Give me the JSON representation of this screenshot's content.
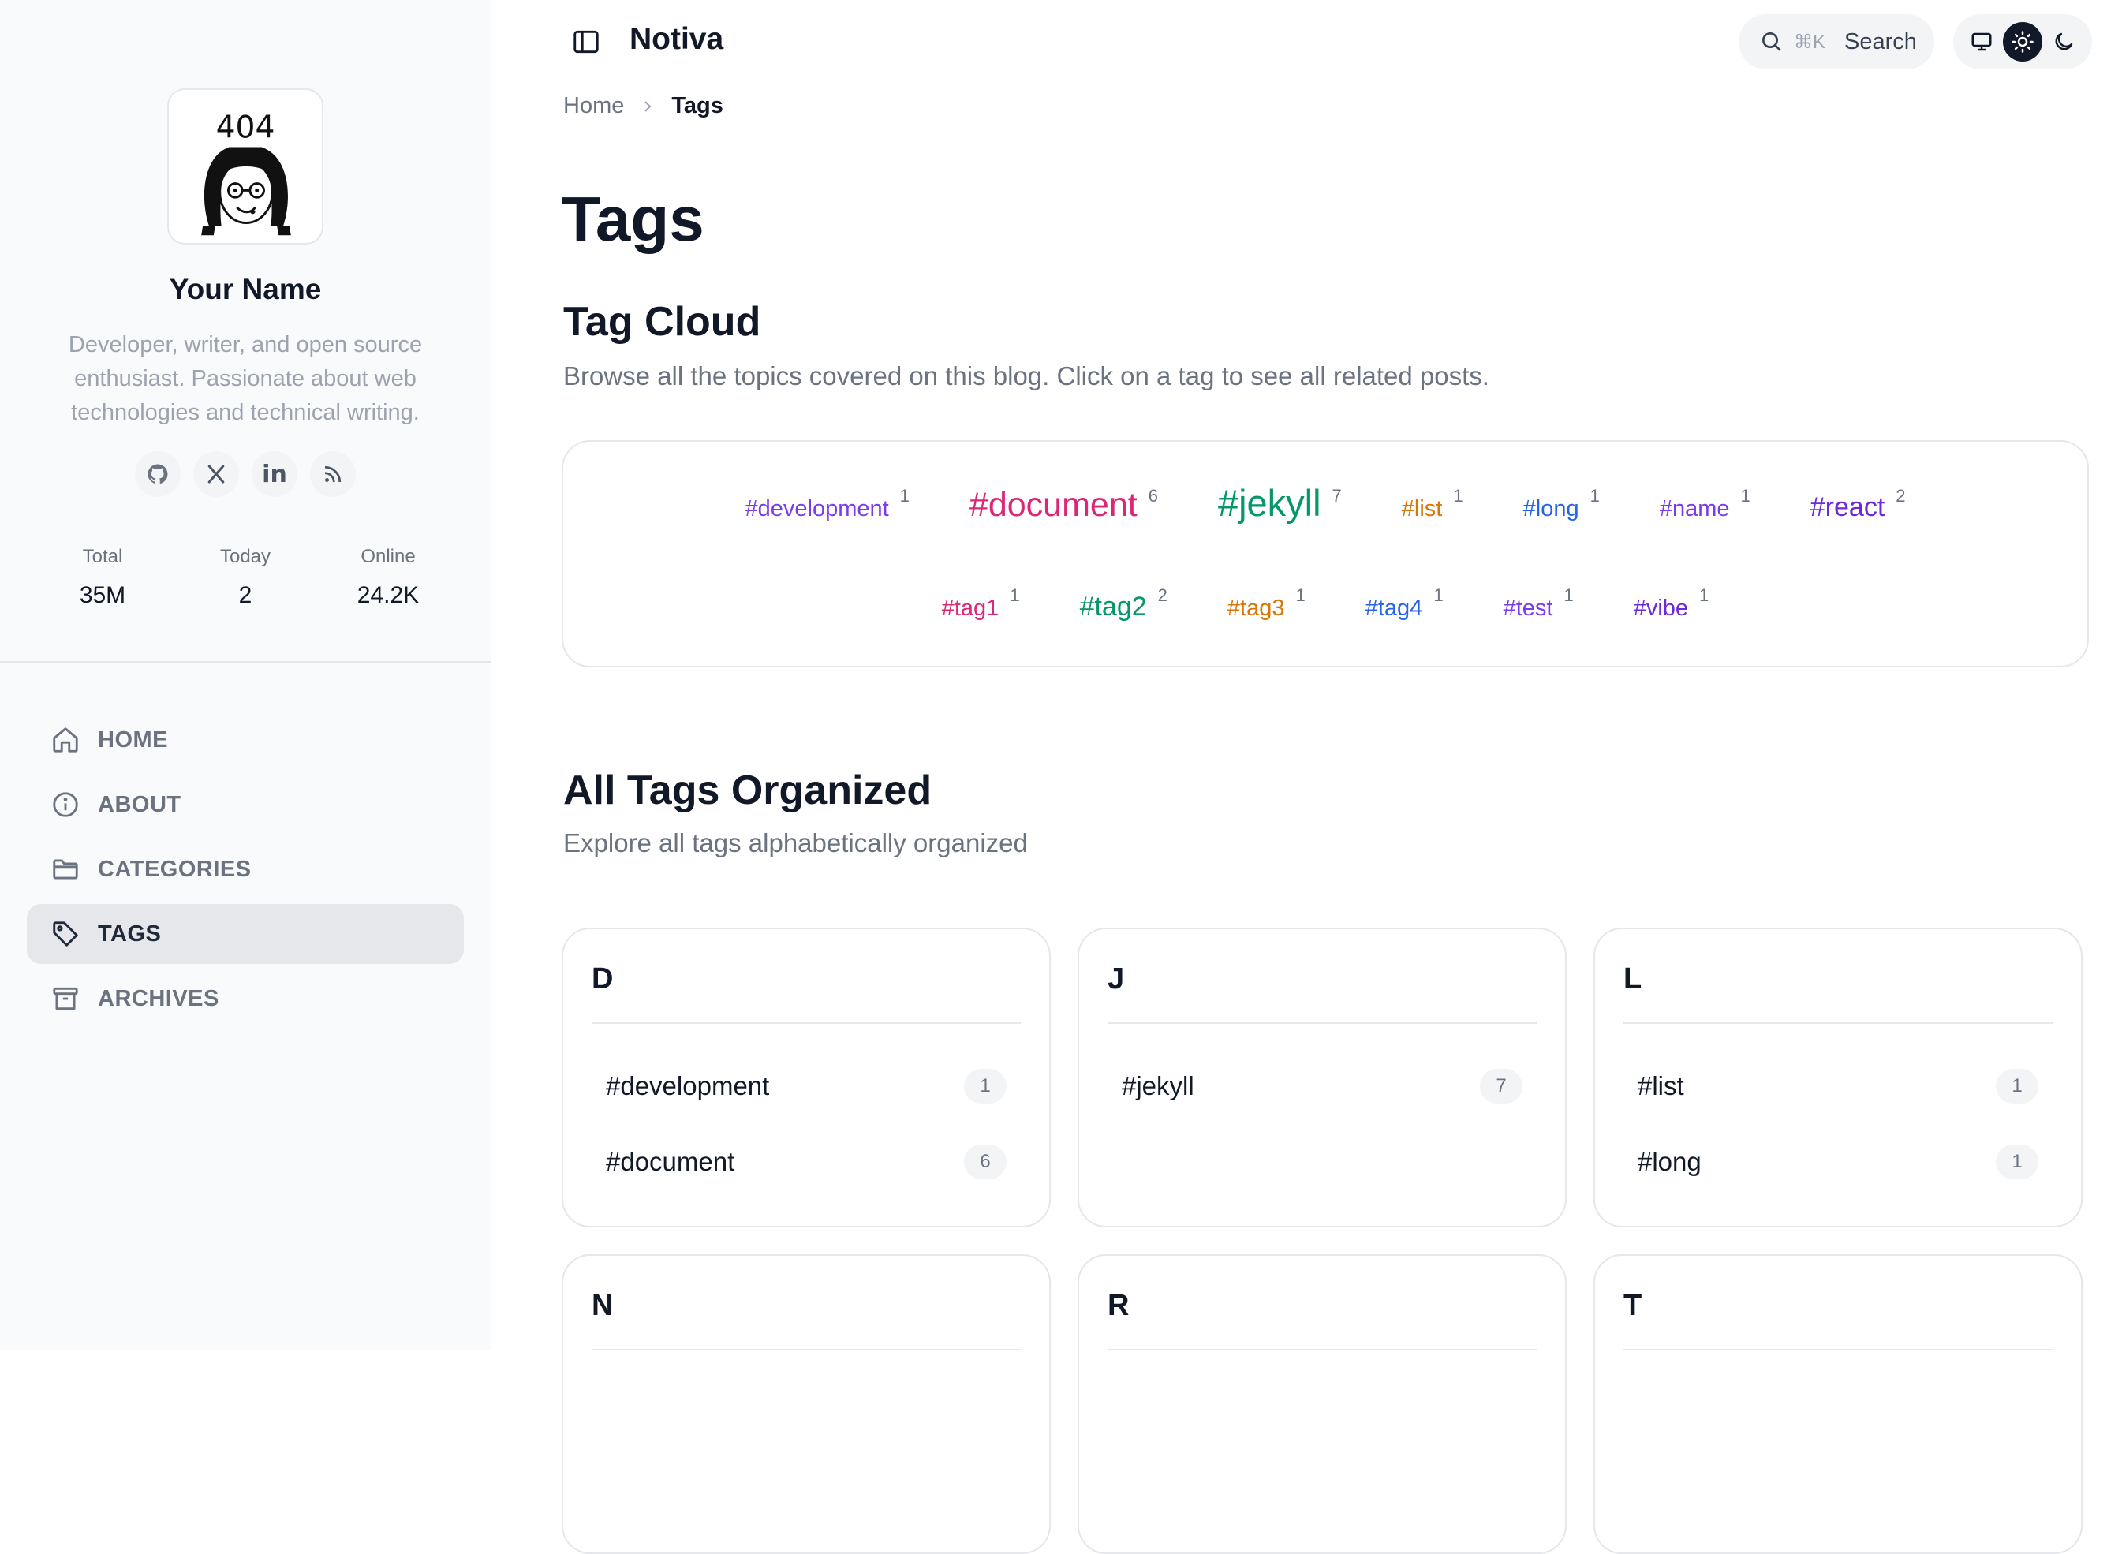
{
  "colors": {
    "sidebar_bg": "#f9fafb",
    "active_nav_bg": "#e5e7eb",
    "muted_text": "#6b7280",
    "cloud_violet": "#7c3aed",
    "cloud_pink": "#db2777",
    "cloud_green": "#059669",
    "cloud_orange": "#d97706",
    "cloud_blue": "#2563eb"
  },
  "sidebar": {
    "avatar_text": "404",
    "name": "Your Name",
    "bio": "Developer, writer, and open source enthusiast. Passionate about web technologies and technical writing.",
    "socials": [
      {
        "icon": "github-icon"
      },
      {
        "icon": "x-icon"
      },
      {
        "icon": "linkedin-icon",
        "label": "in"
      },
      {
        "icon": "rss-icon"
      }
    ],
    "stats": [
      {
        "label": "Total",
        "value": "35M"
      },
      {
        "label": "Today",
        "value": "2"
      },
      {
        "label": "Online",
        "value": "24.2K"
      }
    ],
    "nav": [
      {
        "label": "HOME",
        "icon": "home-icon"
      },
      {
        "label": "ABOUT",
        "icon": "info-icon"
      },
      {
        "label": "CATEGORIES",
        "icon": "folder-icon"
      },
      {
        "label": "TAGS",
        "icon": "tag-icon",
        "active": true
      },
      {
        "label": "ARCHIVES",
        "icon": "archive-icon"
      }
    ]
  },
  "header": {
    "brand": "Notiva",
    "search_shortcut": "⌘K",
    "search_label": "Search"
  },
  "breadcrumb": {
    "home": "Home",
    "current": "Tags"
  },
  "main": {
    "title": "Tags",
    "cloud_title": "Tag Cloud",
    "cloud_desc": "Browse all the topics covered on this blog. Click on a tag to see all related posts.",
    "cloud_rows": [
      [
        {
          "name": "#development",
          "count": "1",
          "color": "#7c3aed"
        },
        {
          "name": "#document",
          "count": "6",
          "color": "#db2777"
        },
        {
          "name": "#jekyll",
          "count": "7",
          "color": "#059669"
        },
        {
          "name": "#list",
          "count": "1",
          "color": "#d97706"
        },
        {
          "name": "#long",
          "count": "1",
          "color": "#2563eb"
        },
        {
          "name": "#name",
          "count": "1",
          "color": "#7c3aed"
        },
        {
          "name": "#react",
          "count": "2",
          "color": "#6d28d9"
        }
      ],
      [
        {
          "name": "#tag1",
          "count": "1",
          "color": "#db2777"
        },
        {
          "name": "#tag2",
          "count": "2",
          "color": "#059669"
        },
        {
          "name": "#tag3",
          "count": "1",
          "color": "#d97706"
        },
        {
          "name": "#tag4",
          "count": "1",
          "color": "#2563eb"
        },
        {
          "name": "#test",
          "count": "1",
          "color": "#7c3aed"
        },
        {
          "name": "#vibe",
          "count": "1",
          "color": "#6d28d9"
        }
      ]
    ],
    "organized_title": "All Tags Organized",
    "organized_desc": "Explore all tags alphabetically organized",
    "groups": [
      {
        "letter": "D",
        "tags": [
          {
            "name": "#development",
            "count": "1"
          },
          {
            "name": "#document",
            "count": "6"
          }
        ]
      },
      {
        "letter": "J",
        "tags": [
          {
            "name": "#jekyll",
            "count": "7"
          }
        ]
      },
      {
        "letter": "L",
        "tags": [
          {
            "name": "#list",
            "count": "1"
          },
          {
            "name": "#long",
            "count": "1"
          }
        ]
      },
      {
        "letter": "N",
        "tags": []
      },
      {
        "letter": "R",
        "tags": []
      },
      {
        "letter": "T",
        "tags": []
      }
    ]
  }
}
